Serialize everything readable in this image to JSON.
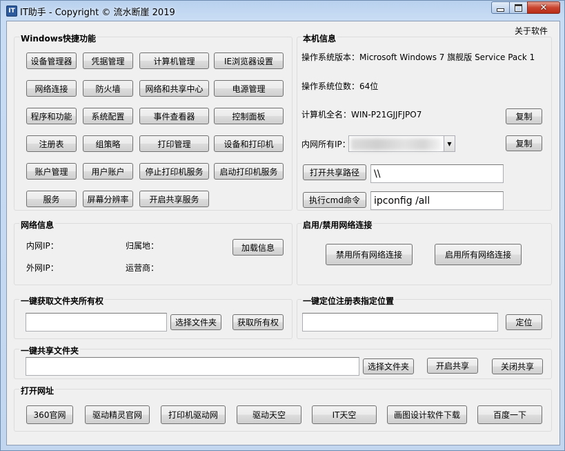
{
  "window": {
    "title": "IT助手 - Copyright © 流水断崖 2019",
    "icon_label": "IT",
    "controls": {
      "minimize": "minimize-icon",
      "maximize": "maximize-icon",
      "close": "close-icon"
    }
  },
  "menu": {
    "about": "关于软件"
  },
  "windows_shortcuts": {
    "title": "Windows快捷功能",
    "buttons": [
      "设备管理器",
      "凭据管理",
      "计算机管理",
      "IE浏览器设置",
      "网络连接",
      "防火墙",
      "网络和共享中心",
      "电源管理",
      "程序和功能",
      "系统配置",
      "事件查看器",
      "控制面板",
      "注册表",
      "组策略",
      "打印管理",
      "设备和打印机",
      "账户管理",
      "用户账户",
      "停止打印机服务",
      "启动打印机服务",
      "服务",
      "屏幕分辨率",
      "开启共享服务"
    ]
  },
  "system_info": {
    "title": "本机信息",
    "os_version": "操作系统版本：Microsoft Windows 7 旗舰版  Service Pack 1",
    "os_bits": "操作系统位数：64位",
    "computer_name": "计算机全名：WIN-P21GJJFJPO7",
    "copy_label": "复制",
    "ip_label": "内网所有IP：",
    "open_share_button": "打开共享路径",
    "share_path_value": "\\\\",
    "run_cmd_button": "执行cmd命令",
    "cmd_value": "ipconfig /all"
  },
  "network_info": {
    "title": "网络信息",
    "lan_ip_label": "内网IP：",
    "location_label": "归属地：",
    "wan_ip_label": "外网IP：",
    "isp_label": "运营商：",
    "load_button": "加载信息"
  },
  "net_toggle": {
    "title": "启用/禁用网络连接",
    "disable_all": "禁用所有网络连接",
    "enable_all": "启用所有网络连接"
  },
  "folder_owner": {
    "title": "一键获取文件夹所有权",
    "path_value": "",
    "choose_button": "选择文件夹",
    "take_button": "获取所有权"
  },
  "registry_locate": {
    "title": "一键定位注册表指定位置",
    "path_value": "",
    "locate_button": "定位"
  },
  "share_folder": {
    "title": "一键共享文件夹",
    "path_value": "",
    "choose_button": "选择文件夹",
    "open_button": "开启共享",
    "close_button": "关闭共享"
  },
  "open_urls": {
    "title": "打开网址",
    "buttons": [
      "360官网",
      "驱动精灵官网",
      "打印机驱动网",
      "驱动天空",
      "IT天空",
      "画图设计软件下载",
      "百度一下"
    ]
  }
}
